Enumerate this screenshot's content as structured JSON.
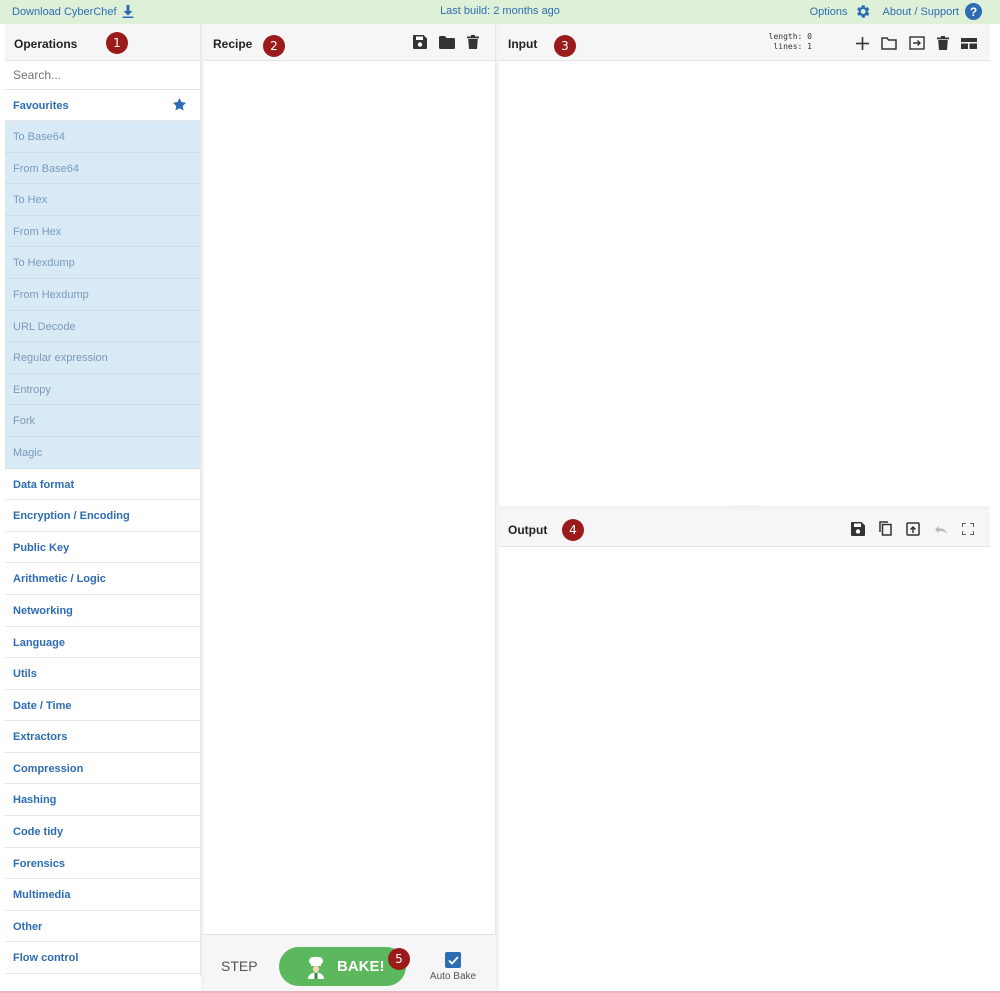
{
  "banner": {
    "download": "Download CyberChef",
    "last_build": "Last build: 2 months ago",
    "options": "Options",
    "about": "About / Support"
  },
  "operations": {
    "title": "Operations",
    "badge": "1",
    "search_placeholder": "Search...",
    "favourites_label": "Favourites",
    "favourites": [
      "To Base64",
      "From Base64",
      "To Hex",
      "From Hex",
      "To Hexdump",
      "From Hexdump",
      "URL Decode",
      "Regular expression",
      "Entropy",
      "Fork",
      "Magic"
    ],
    "categories": [
      "Data format",
      "Encryption / Encoding",
      "Public Key",
      "Arithmetic / Logic",
      "Networking",
      "Language",
      "Utils",
      "Date / Time",
      "Extractors",
      "Compression",
      "Hashing",
      "Code tidy",
      "Forensics",
      "Multimedia",
      "Other",
      "Flow control"
    ]
  },
  "recipe": {
    "title": "Recipe",
    "badge": "2",
    "step_label": "STEP",
    "bake_label": "BAKE!",
    "bake_badge": "5",
    "auto_bake_label": "Auto Bake",
    "auto_bake_checked": true
  },
  "input": {
    "title": "Input",
    "badge": "3",
    "length_label": "length:",
    "length_value": "0",
    "lines_label": "lines:",
    "lines_value": "1"
  },
  "output": {
    "title": "Output",
    "badge": "4"
  },
  "colors": {
    "accent": "#2d6cb3",
    "badge": "#9b1b1b",
    "bake": "#5cb85c",
    "banner": "#dff0d8",
    "favourite_bg": "#d8eaf6"
  }
}
